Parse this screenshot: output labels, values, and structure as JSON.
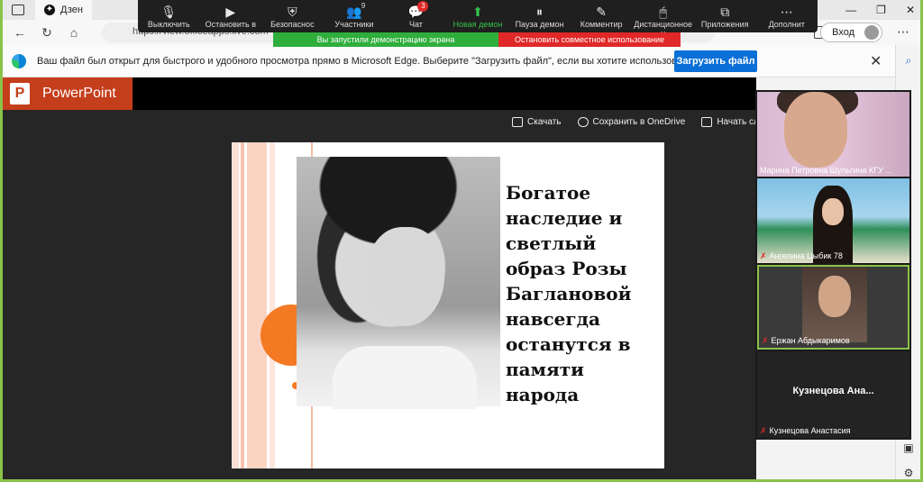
{
  "browser": {
    "tab_title": "Дзен",
    "url": "https://view.officeapps.live.com",
    "login": "Вход"
  },
  "zoom_toolbar": {
    "items": [
      {
        "label": "Выключить",
        "icon": "mic"
      },
      {
        "label": "Остановить в",
        "icon": "video"
      },
      {
        "label": "Безопаснос",
        "icon": "shield"
      },
      {
        "label": "Участники",
        "icon": "people",
        "count": "9"
      },
      {
        "label": "Чат",
        "icon": "chat",
        "badge": "3"
      },
      {
        "label": "Новая демон",
        "icon": "share",
        "green": true
      },
      {
        "label": "Пауза демон",
        "icon": "pause"
      },
      {
        "label": "Комментир",
        "icon": "pen"
      },
      {
        "label": "Дистанционное у",
        "icon": "mouse"
      },
      {
        "label": "Приложения",
        "icon": "apps"
      },
      {
        "label": "Дополнит",
        "icon": "more"
      }
    ],
    "share_notice": "Вы запустили демонстрацию экрана",
    "stop_share": "Остановить совместное использование"
  },
  "notification": {
    "text": "Ваш файл был открыт для быстрого и удобного просмотра прямо в Microsoft Edge. Выберите \"Загрузить файл\", если вы хотите использовать его позже.",
    "button": "Загрузить файл"
  },
  "powerpoint": {
    "app_name": "PowerPoint",
    "actions": {
      "download": "Скачать",
      "save": "Сохранить в OneDrive",
      "present": "Начать слайд"
    },
    "slide_text": "Богатое наследие и светлый образ Розы Баглановой навсегда останутся в памяти народа"
  },
  "participants": [
    {
      "name": "Марина Петровна Шульгина  КГУ ..."
    },
    {
      "name": "Ангелина Цыбик 78"
    },
    {
      "name": "Ержан Абдыкаримов"
    },
    {
      "name": "Кузнецова Анастасия",
      "big": "Кузнецова  Ана..."
    }
  ]
}
